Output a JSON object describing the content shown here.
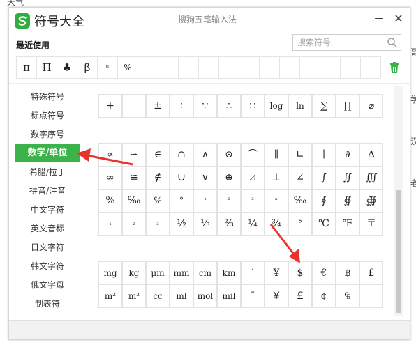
{
  "background": {
    "top_left_text": "天气",
    "right_peeks": [
      "哥",
      "学",
      "汉",
      "老"
    ]
  },
  "window": {
    "app_title": "符号大全",
    "ime_name": "搜狗五笔输入法"
  },
  "titlebar": {
    "minimize_glyph": "—",
    "close_glyph": "✕"
  },
  "recent": {
    "label": "最近使用",
    "symbols": [
      "π",
      "Π",
      "♣",
      "β",
      "ⁿ",
      "%",
      "",
      "",
      "",
      "",
      "",
      "",
      "",
      "",
      "",
      "",
      "",
      ""
    ]
  },
  "search": {
    "placeholder": "搜索符号",
    "value": ""
  },
  "sidebar": {
    "items": [
      {
        "label": "特殊符号"
      },
      {
        "label": "标点符号"
      },
      {
        "label": "数字序号"
      },
      {
        "label": "数学/单位",
        "active": true
      },
      {
        "label": "希腊/拉丁"
      },
      {
        "label": "拼音/注音"
      },
      {
        "label": "中文字符"
      },
      {
        "label": "英文音标"
      },
      {
        "label": "日文字符"
      },
      {
        "label": "韩文字符"
      },
      {
        "label": "俄文字母"
      },
      {
        "label": "制表符"
      }
    ]
  },
  "grid": {
    "partial_row": [
      "+",
      "－",
      "±",
      "∶",
      "∵",
      "∴",
      "∷",
      "log",
      "ln",
      "∑",
      "∏",
      "⌀"
    ],
    "rows1": [
      [
        "∝",
        "∽",
        "∈",
        "∩",
        "∧",
        "⊙",
        "⌒",
        "∥",
        "∟",
        "∣",
        "∂",
        "∆"
      ],
      [
        "∞",
        "≌",
        "∉",
        "∪",
        "∨",
        "⊕",
        "⊿",
        "⊥",
        "∠",
        "∫",
        "∬",
        "∭"
      ],
      [
        "%",
        "‰",
        "℅",
        "°",
        "¹",
        "²",
        "³",
        "ⁿ",
        "‰",
        "∮",
        "∯",
        "∰"
      ],
      [
        "₁",
        "₂",
        "₃",
        "½",
        "⅓",
        "⅔",
        "¼",
        "¾",
        "°",
        "℃",
        "℉",
        "〒"
      ]
    ],
    "rows2": [
      [
        "mg",
        "kg",
        "μm",
        "mm",
        "cm",
        "km",
        "′",
        "¥",
        "$",
        "€",
        "฿",
        "£"
      ],
      [
        "m²",
        "m³",
        "cc",
        "ml",
        "mol",
        "mil",
        "″",
        "￥",
        "￡",
        "¢",
        "₠",
        ""
      ]
    ]
  },
  "colors": {
    "accent": "#3cb34a",
    "arrow": "#e8322a",
    "brand": "#2fae3f"
  }
}
